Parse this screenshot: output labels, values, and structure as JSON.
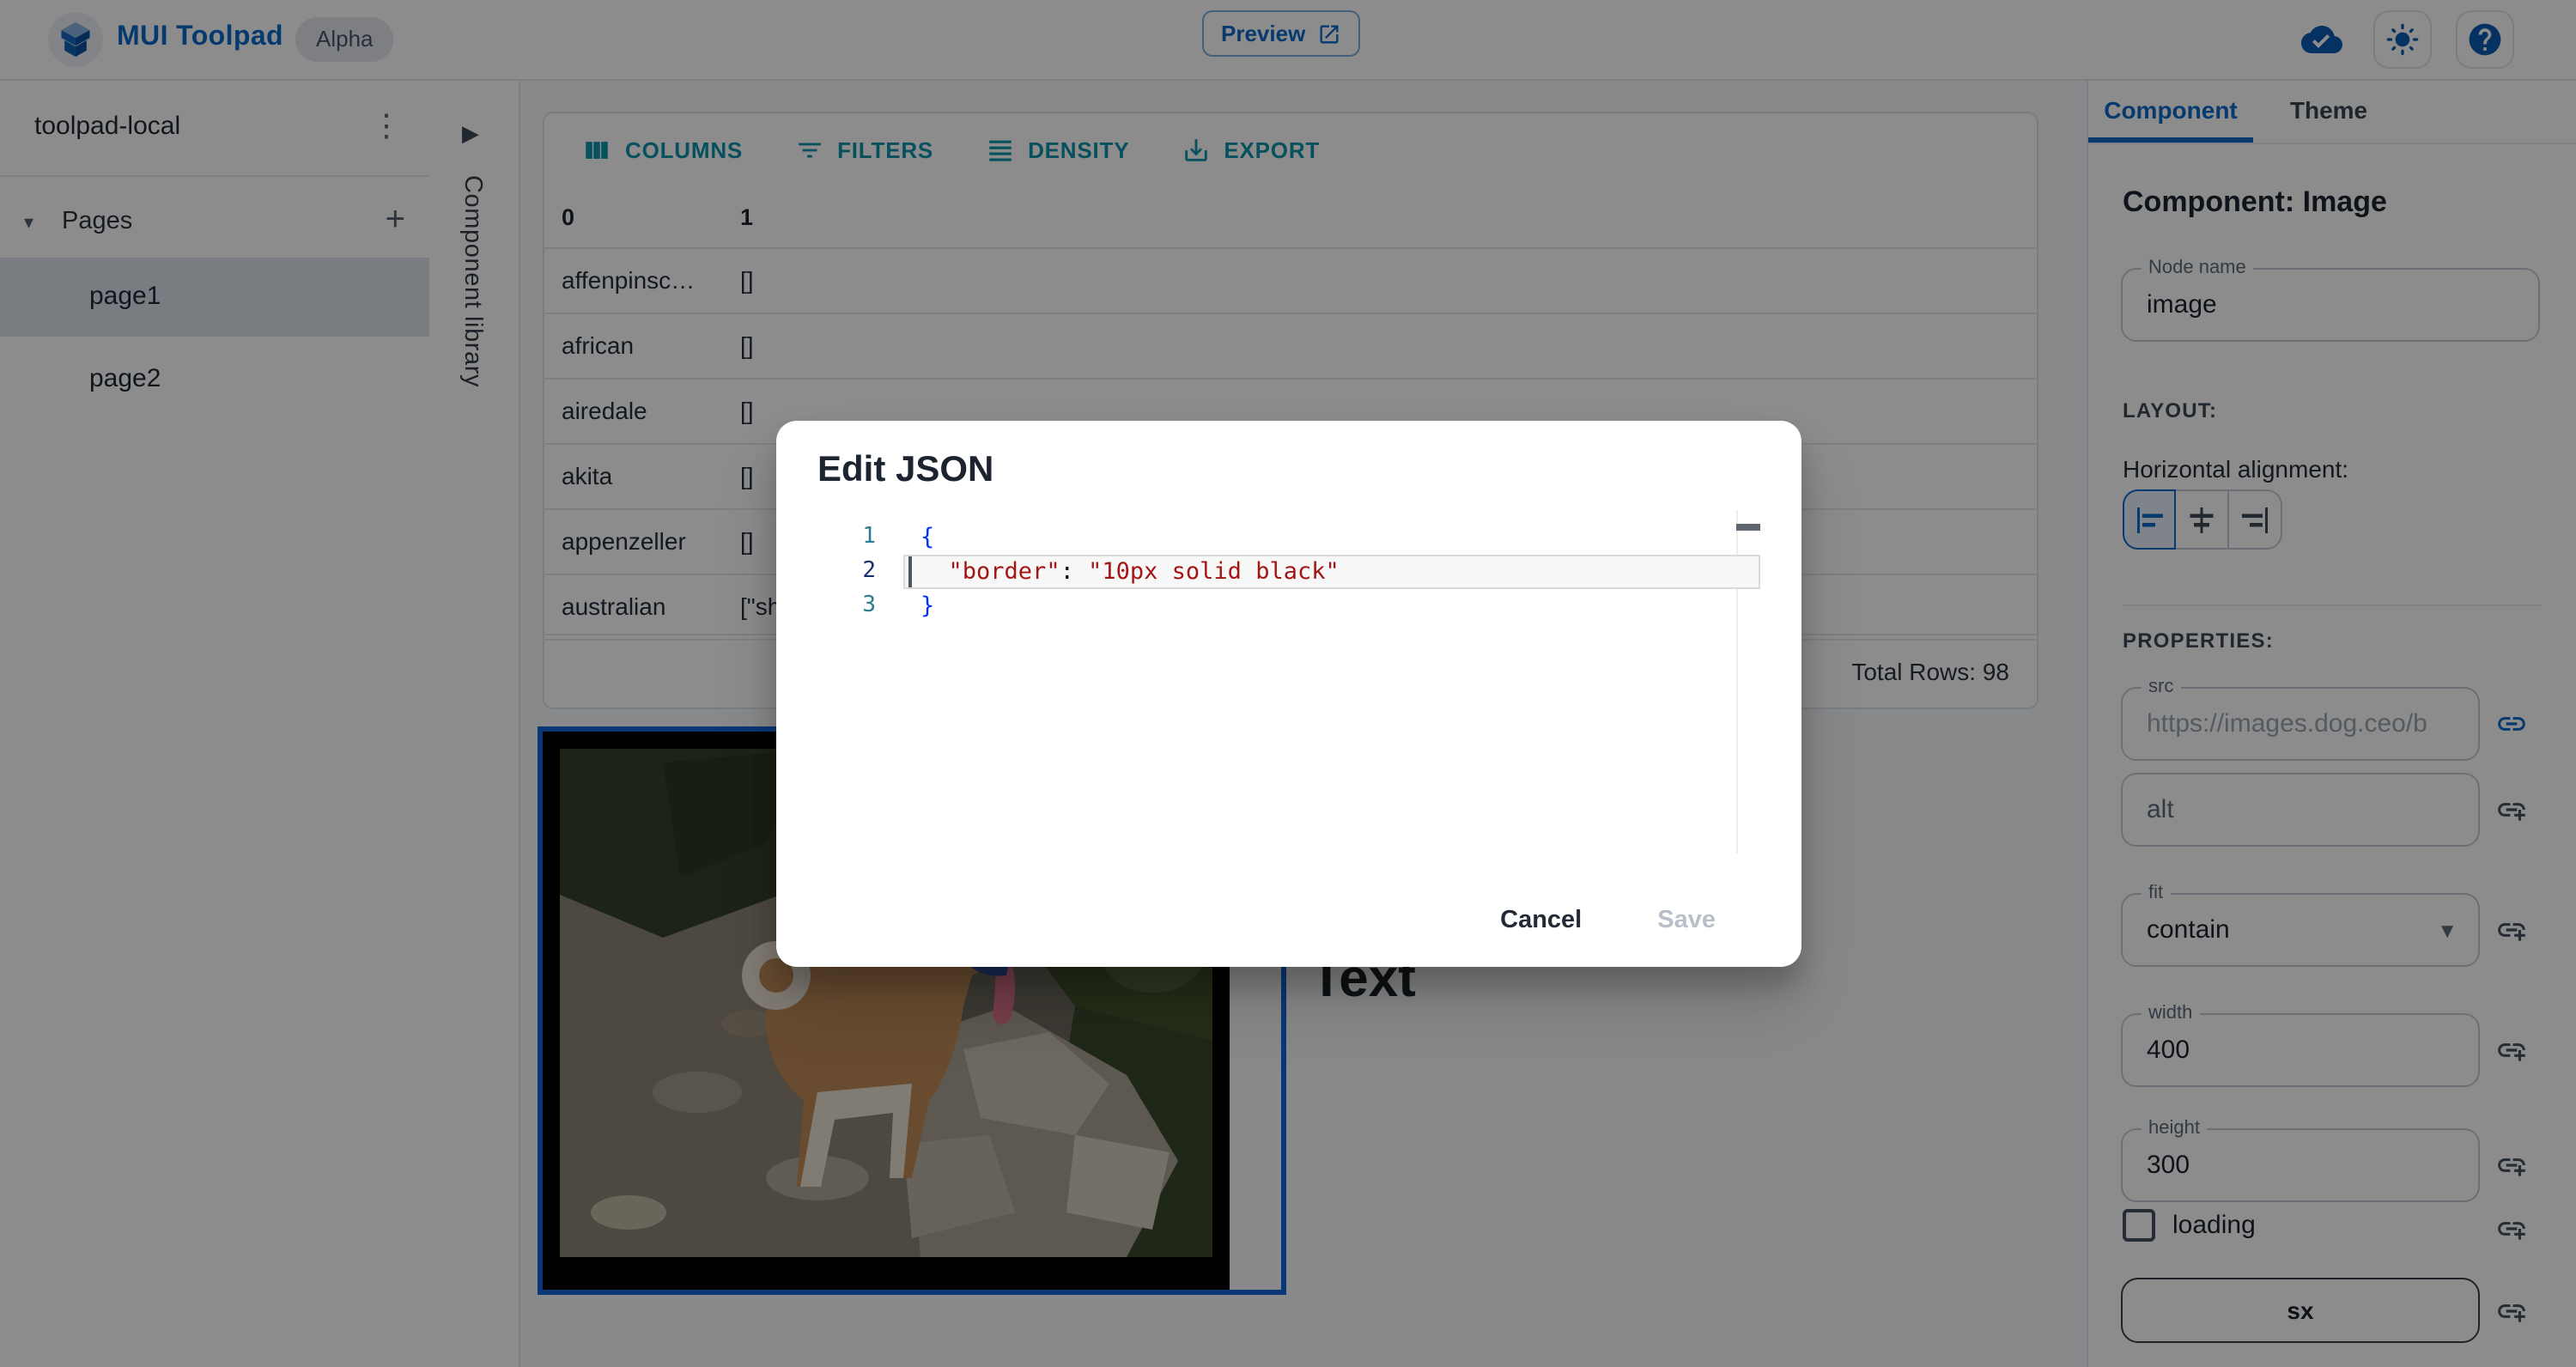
{
  "topbar": {
    "brand": "MUI Toolpad",
    "badge": "Alpha",
    "preview_label": "Preview"
  },
  "sidebar": {
    "project": "toolpad-local",
    "pages_header": "Pages",
    "pages": [
      {
        "label": "page1",
        "selected": true
      },
      {
        "label": "page2",
        "selected": false
      }
    ]
  },
  "library": {
    "label": "Component library"
  },
  "grid": {
    "toolbar": [
      "COLUMNS",
      "FILTERS",
      "DENSITY",
      "EXPORT"
    ],
    "columns": [
      "0",
      "1"
    ],
    "rows": [
      [
        "affenpinsc…",
        "[]"
      ],
      [
        "african",
        "[]"
      ],
      [
        "airedale",
        "[]"
      ],
      [
        "akita",
        "[]"
      ],
      [
        "appenzeller",
        "[]"
      ],
      [
        "australian",
        "[\"sh"
      ]
    ],
    "footer": "Total Rows: 98"
  },
  "canvas": {
    "text_component": "Text"
  },
  "dialog": {
    "title": "Edit JSON",
    "code": {
      "line_numbers": [
        "1",
        "2",
        "3"
      ],
      "line1": "{",
      "line2_indent": "  ",
      "line2_key": "\"border\"",
      "line2_sep": ": ",
      "line2_value": "\"10px solid black\"",
      "line3": "}"
    },
    "cancel_label": "Cancel",
    "save_label": "Save"
  },
  "panel": {
    "tabs": [
      "Component",
      "Theme"
    ],
    "heading": "Component: Image",
    "node_name": {
      "label": "Node name",
      "value": "image"
    },
    "layout_label": "LAYOUT:",
    "halign_label": "Horizontal alignment:",
    "properties_label": "PROPERTIES:",
    "src": {
      "label": "src",
      "value": "https://images.dog.ceo/b"
    },
    "alt": {
      "label": "alt"
    },
    "fit": {
      "label": "fit",
      "value": "contain"
    },
    "width": {
      "label": "width",
      "value": "400"
    },
    "height": {
      "label": "height",
      "value": "300"
    },
    "loading_label": "loading",
    "sx_label": "sx"
  },
  "colors": {
    "accent_blue": "#0b6bcb",
    "grid_toolbar_teal": "#0e94ab",
    "selection_blue": "#1565d8",
    "code_key_red": "#a31515",
    "code_brace_blue": "#0431fa",
    "backdrop": "rgba(0,0,0,0.45)"
  }
}
